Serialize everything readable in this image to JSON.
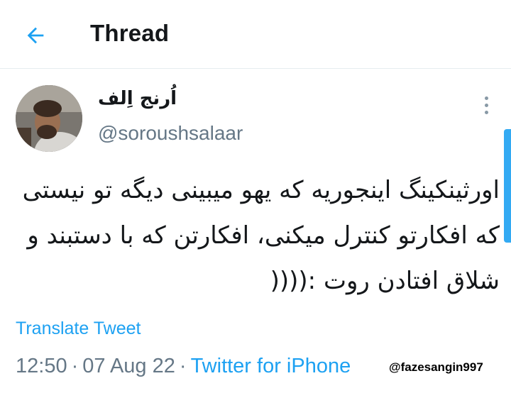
{
  "header": {
    "back_icon": "arrow-left-icon",
    "title": "Thread"
  },
  "tweet": {
    "display_name": "اُرنج اِلف",
    "handle": "@soroushsalaar",
    "more_icon": "more-vertical-icon",
    "text": "اورثینکینگ اینجوریه که یهو میبینی دیگه تو نیستی که افکارتو کنترل میکنی، افکارتن که با دستبند و شلاق افتادن روت :((((",
    "translate_label": "Translate Tweet",
    "time": "12:50",
    "date": "07 Aug 22",
    "source": "Twitter for iPhone"
  },
  "watermark": "@fazesangin997",
  "colors": {
    "accent": "#1da1f2",
    "text": "#14171a",
    "secondary": "#657786"
  }
}
